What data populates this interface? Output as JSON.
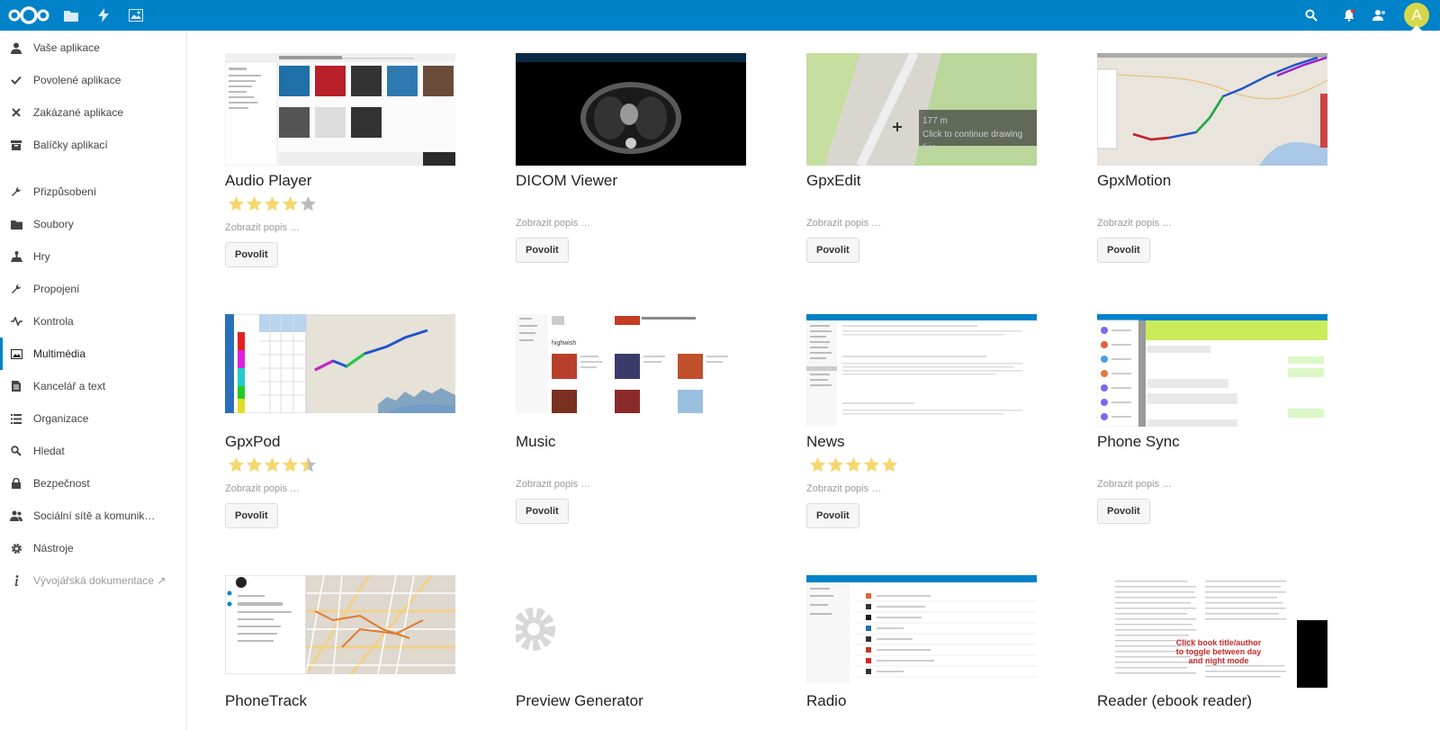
{
  "header": {
    "nav": [
      "files-icon",
      "activity-icon",
      "gallery-icon"
    ],
    "avatar_letter": "A",
    "accent": "#0082c9",
    "avatar_color": "#d6d84b"
  },
  "sidebar": {
    "items": [
      {
        "label": "Vaše aplikace",
        "icon": "user-icon"
      },
      {
        "label": "Povolené aplikace",
        "icon": "check-icon"
      },
      {
        "label": "Zakázané aplikace",
        "icon": "close-icon"
      },
      {
        "label": "Balíčky aplikací",
        "icon": "bundle-icon"
      },
      {
        "label": "Přizpůsobení",
        "icon": "wrench-icon"
      },
      {
        "label": "Soubory",
        "icon": "folder-icon"
      },
      {
        "label": "Hry",
        "icon": "games-icon"
      },
      {
        "label": "Propojení",
        "icon": "integration-icon"
      },
      {
        "label": "Kontrola",
        "icon": "monitoring-icon"
      },
      {
        "label": "Multimédia",
        "icon": "image-icon"
      },
      {
        "label": "Kancelář a text",
        "icon": "document-icon"
      },
      {
        "label": "Organizace",
        "icon": "list-icon"
      },
      {
        "label": "Hledat",
        "icon": "search-icon"
      },
      {
        "label": "Bezpečnost",
        "icon": "lock-icon"
      },
      {
        "label": "Sociální sítě a komunik…",
        "icon": "social-icon"
      },
      {
        "label": "Nástroje",
        "icon": "gear-icon"
      },
      {
        "label": "Vývojářská dokumentace ↗",
        "icon": "info-icon"
      }
    ]
  },
  "apps": [
    {
      "name": "Audio Player",
      "rating": 4,
      "desc": "Zobrazit popis …",
      "button": "Povolit"
    },
    {
      "name": "DICOM Viewer",
      "rating": null,
      "desc": "Zobrazit popis …",
      "button": "Povolit"
    },
    {
      "name": "GpxEdit",
      "rating": null,
      "desc": "Zobrazit popis …",
      "button": "Povolit",
      "shot_text": [
        "177 m",
        "Click to continue drawing line"
      ]
    },
    {
      "name": "GpxMotion",
      "rating": null,
      "desc": "Zobrazit popis …",
      "button": "Povolit"
    },
    {
      "name": "GpxPod",
      "rating": 4.5,
      "desc": "Zobrazit popis …",
      "button": "Povolit"
    },
    {
      "name": "Music",
      "rating": null,
      "desc": "Zobrazit popis …",
      "button": "Povolit",
      "shot_text": [
        "highwish"
      ]
    },
    {
      "name": "News",
      "rating": 5,
      "desc": "Zobrazit popis …",
      "button": "Povolit"
    },
    {
      "name": "Phone Sync",
      "rating": null,
      "desc": "Zobrazit popis …",
      "button": "Povolit"
    },
    {
      "name": "PhoneTrack",
      "rating": null
    },
    {
      "name": "Preview Generator",
      "rating": null
    },
    {
      "name": "Radio",
      "rating": null
    },
    {
      "name": "Reader (ebook reader)",
      "rating": null,
      "shot_text": [
        "Click book title/author",
        "to toggle between day",
        "and night mode"
      ]
    }
  ]
}
